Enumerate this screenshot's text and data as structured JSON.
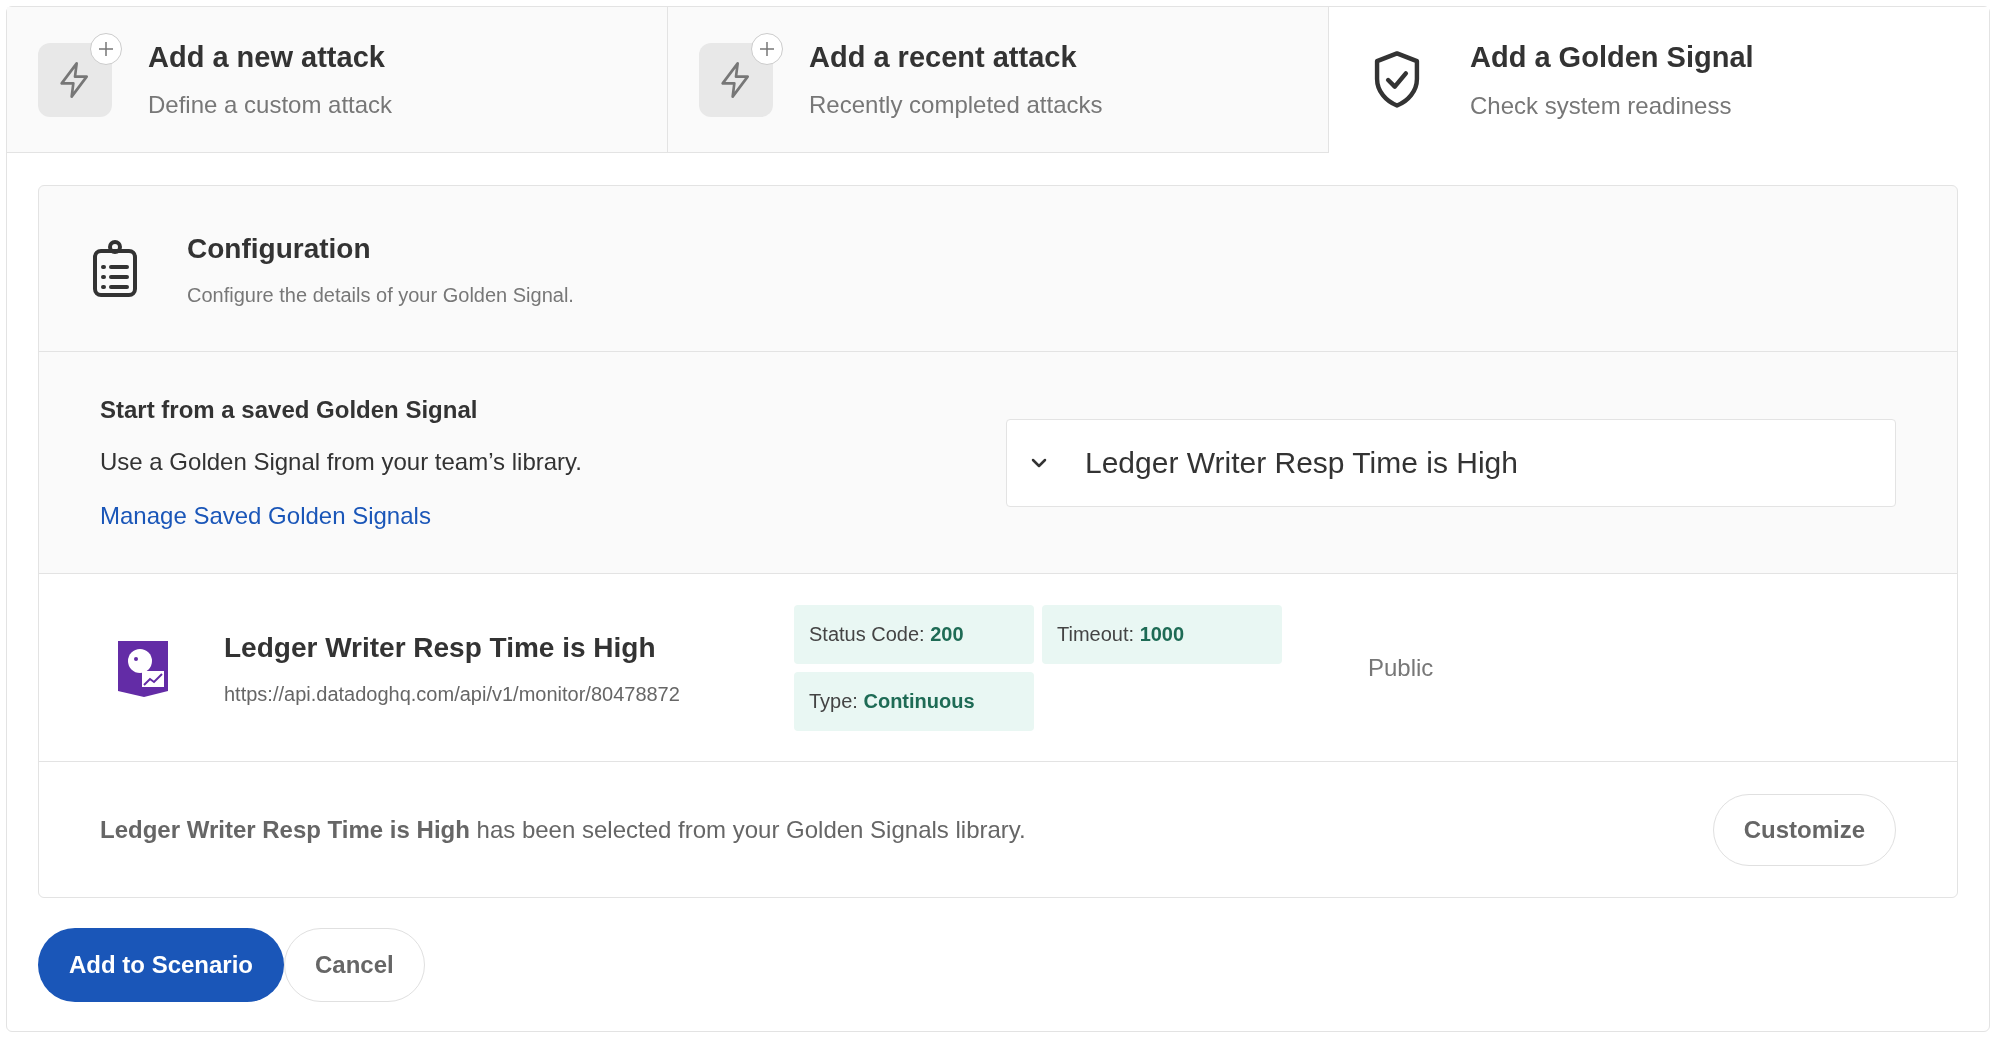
{
  "tabs": [
    {
      "kind": "attack",
      "title": "Add a new attack",
      "subtitle": "Define a custom attack",
      "selected": false
    },
    {
      "kind": "attack",
      "title": "Add a recent attack",
      "subtitle": "Recently completed attacks",
      "selected": false
    },
    {
      "kind": "signal",
      "title": "Add a Golden Signal",
      "subtitle": "Check system readiness",
      "selected": true
    }
  ],
  "configuration": {
    "title": "Configuration",
    "subtitle": "Configure the details of your Golden Signal."
  },
  "saved": {
    "title": "Start from a saved Golden Signal",
    "description": "Use a Golden Signal from your team’s library.",
    "link": "Manage Saved Golden Signals",
    "dropdown_value": "Ledger Writer Resp Time is High"
  },
  "signal": {
    "name": "Ledger Writer Resp Time is High",
    "url": "https://api.datadoghq.com/api/v1/monitor/80478872",
    "tags": [
      {
        "label": "Status Code:",
        "value": "200"
      },
      {
        "label": "Timeout:",
        "value": "1000"
      },
      {
        "label": "Type:",
        "value": "Continuous"
      }
    ],
    "visibility": "Public"
  },
  "notice": {
    "text": "**Ledger Writer Resp Time is High** has been selected from your Golden Signals library.",
    "button": "Customize"
  },
  "buttons": [
    {
      "kind": "primary",
      "label": "Add to Scenario"
    },
    {
      "kind": "secondary",
      "label": "Cancel"
    }
  ]
}
